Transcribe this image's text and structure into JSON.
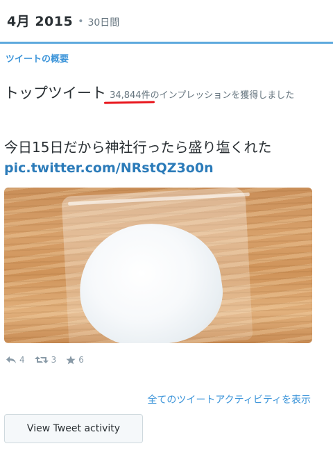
{
  "header": {
    "month": "4月 2015",
    "separator": "•",
    "period": "30日間"
  },
  "section_title": "ツイートの概要",
  "top_tweet": {
    "label": "トップツイート",
    "impressions_count": "34,844件",
    "impressions_text": "のインプレッションを獲得しました"
  },
  "tweet": {
    "text": "今日15日だから神社行ったら盛り塩くれた",
    "link": "pic.twitter.com/NRstQZ3o0n"
  },
  "actions": {
    "replies": "4",
    "retweets": "3",
    "favorites": "6"
  },
  "all_activity_link": "全てのツイートアクティビティを表示",
  "view_button": "View Tweet activity",
  "colors": {
    "accent": "#3b94d9",
    "rule": "#5ea9dd",
    "link": "#2b7bb9",
    "underline": "#e8141b"
  }
}
